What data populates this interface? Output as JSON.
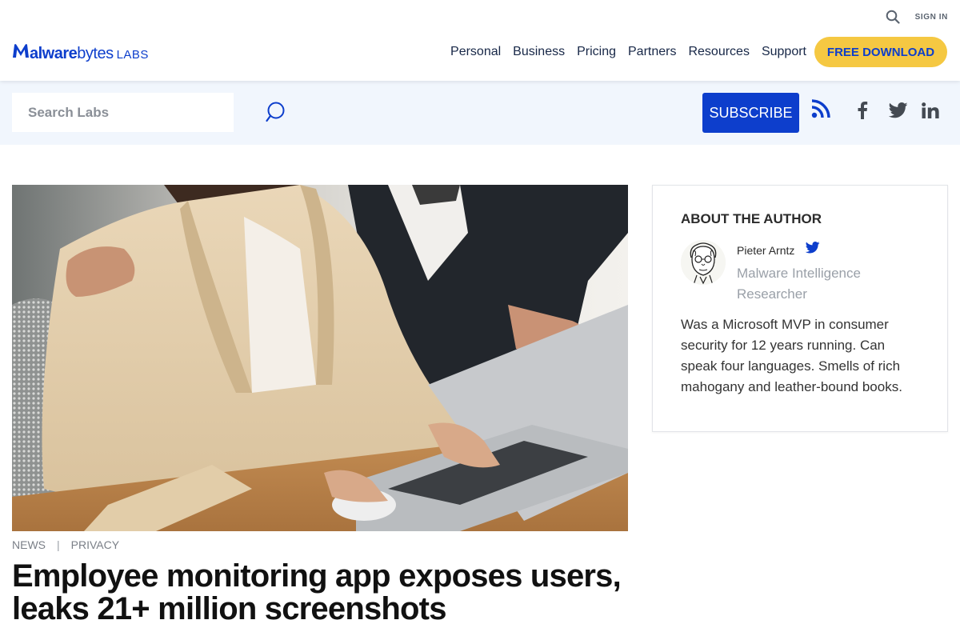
{
  "header": {
    "sign_in": "SIGN IN",
    "logo": {
      "brand_bold": "alware",
      "brand_light": "bytes",
      "labs": "LABS"
    },
    "nav": [
      {
        "label": "Personal"
      },
      {
        "label": "Business"
      },
      {
        "label": "Pricing"
      },
      {
        "label": "Partners"
      },
      {
        "label": "Resources"
      },
      {
        "label": "Support"
      }
    ],
    "download_label": "FREE DOWNLOAD"
  },
  "subbar": {
    "search_placeholder": "Search Labs",
    "subscribe_label": "SUBSCRIBE",
    "social_icons": [
      "rss-icon",
      "facebook-icon",
      "twitter-icon",
      "linkedin-icon"
    ]
  },
  "article": {
    "categories": [
      "NEWS",
      "PRIVACY"
    ],
    "separator": "|",
    "title": "Employee monitoring app exposes users, leaks 21+ million screenshots"
  },
  "author": {
    "heading": "ABOUT THE AUTHOR",
    "name": "Pieter Arntz",
    "role": "Malware Intelligence Researcher",
    "bio": "Was a Microsoft MVP in consumer security for 12 years running. Can speak four languages. Smells of rich mahogany and leather-bound books."
  },
  "colors": {
    "brand_blue": "#0d3ecc",
    "download_yellow": "#f5c842",
    "subbar_bg": "#f1f6fd",
    "nav_text": "#172747"
  }
}
